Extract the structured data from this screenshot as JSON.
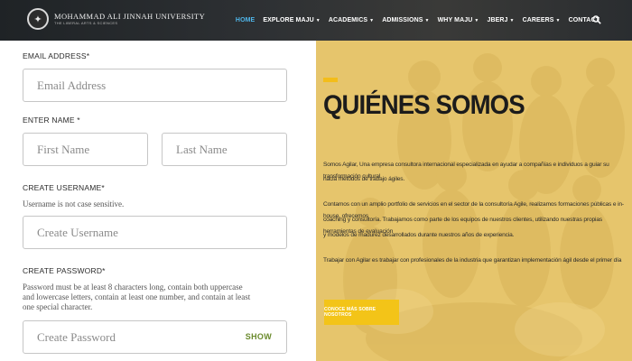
{
  "header": {
    "logo_name": "MOHAMMAD ALI JINNAH UNIVERSITY",
    "logo_tagline": "THE LIBERAL ARTS & SCIENCES",
    "nav": [
      {
        "label": "HOME",
        "active": true,
        "dropdown": false
      },
      {
        "label": "EXPLORE MAJU",
        "active": false,
        "dropdown": true
      },
      {
        "label": "ACADEMICS",
        "active": false,
        "dropdown": true
      },
      {
        "label": "ADMISSIONS",
        "active": false,
        "dropdown": true
      },
      {
        "label": "WHY MAJU",
        "active": false,
        "dropdown": true
      },
      {
        "label": "JBERJ",
        "active": false,
        "dropdown": true
      },
      {
        "label": "CAREERS",
        "active": false,
        "dropdown": true
      },
      {
        "label": "CONTACT",
        "active": false,
        "dropdown": false
      }
    ],
    "search_icon": "search-icon"
  },
  "form": {
    "email_label": "EMAIL ADDRESS*",
    "email_placeholder": "Email Address",
    "name_label": "ENTER NAME *",
    "first_name_placeholder": "First Name",
    "last_name_placeholder": "Last Name",
    "username_label": "CREATE USERNAME*",
    "username_hint": "Username is not case sensitive.",
    "username_placeholder": "Create Username",
    "password_label": "CREATE PASSWORD*",
    "password_hint_1": "Password must be at least 8 characters long, contain both uppercase",
    "password_hint_2": "and lowercase letters, contain at least one number, and contain at least",
    "password_hint_3": "one special character.",
    "password_placeholder": "Create Password",
    "show_label": "SHOW"
  },
  "hero": {
    "title": "QUIÉNES SOMOS",
    "p1_line1": "Somos Agilar, Una empresa consultora internacional especializada en ayudar a compañías e individuos a guiar su transformación cultural",
    "p1_line2": "hacia métodos de trabajo ágiles.",
    "p2_line1": "Contamos con un amplio portfolio de servicios en el sector de la consultoría Agile, realizamos formaciones públicas e in-house, ofrecemos",
    "p2_line2": "coaching y consultoría. Trabajamos como parte de los equipos de nuestros clientes, utilizando nuestras propias herramientas de evaluación",
    "p2_line3": "y modelos de madurez desarrollados durante nuestros años de experiencia.",
    "p3_line1": "Trabajar con Agilar es trabajar con profesionales de la industria que garantizan implementación ágil desde el primer día",
    "button_label": "CONOCE MÁS SOBRE NOSOTROS",
    "colors": {
      "overlay": "#e7c56a",
      "accent": "#f3bd1a",
      "button": "#f3c418"
    }
  }
}
